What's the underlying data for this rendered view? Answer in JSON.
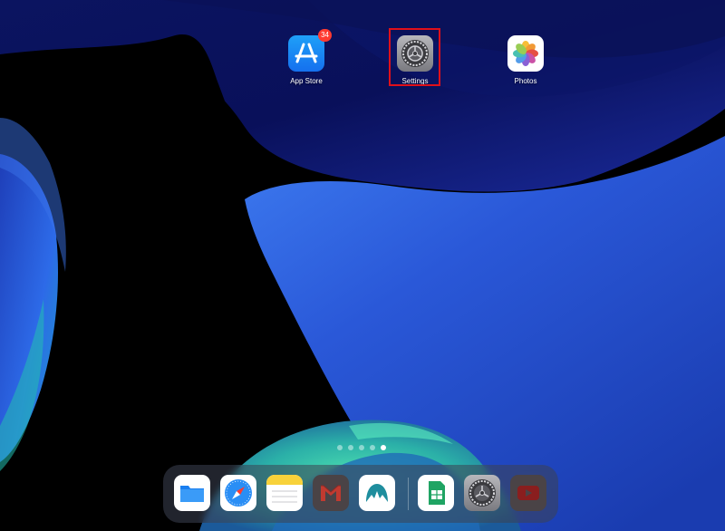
{
  "home_apps": [
    {
      "label": "App Store",
      "badge": "34",
      "icon": "app-store-icon"
    },
    {
      "label": "Settings",
      "icon": "settings-gear-icon"
    },
    {
      "label": "Photos",
      "icon": "photos-icon"
    }
  ],
  "page_indicator": {
    "count": 5,
    "active_index": 4
  },
  "dock_apps": [
    {
      "icon": "files-icon"
    },
    {
      "icon": "safari-icon"
    },
    {
      "icon": "notes-icon"
    },
    {
      "icon": "gmail-icon"
    },
    {
      "icon": "nordvpn-icon"
    },
    {
      "icon": "google-sheets-icon"
    },
    {
      "icon": "settings-gear-icon"
    },
    {
      "icon": "youtube-icon"
    }
  ],
  "highlight": {
    "target": "Settings",
    "color": "#e0101a"
  },
  "colors": {
    "wallpaper_blue": "#1f3fb8",
    "wallpaper_dark": "#060c3a",
    "badge": "#ff3b30"
  }
}
